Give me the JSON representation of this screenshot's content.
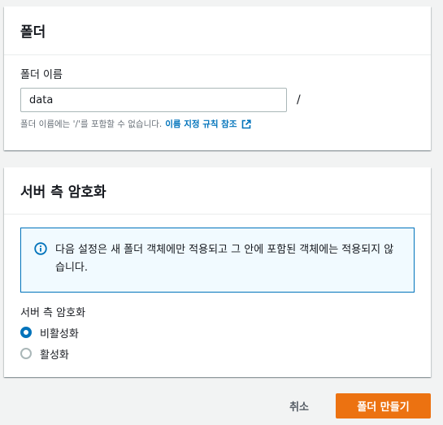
{
  "folder_panel": {
    "title": "폴더",
    "name_label": "폴더 이름",
    "name_value": "data",
    "slash": "/",
    "hint_text": "폴더 이름에는 '/'를 포함할 수 없습니다.",
    "hint_link": "이름 지정 규칙 참조",
    "hint_link_icon": "external-link-icon"
  },
  "encryption_panel": {
    "title": "서버 측 암호화",
    "info_icon": "info-icon",
    "info_text": "다음 설정은 새 폴더 객체에만 적용되고 그 안에 포함된 객체에는 적용되지 않습니다.",
    "group_label": "서버 측 암호화",
    "options": [
      {
        "label": "비활성화",
        "checked": true
      },
      {
        "label": "활성화",
        "checked": false
      }
    ]
  },
  "footer": {
    "cancel_label": "취소",
    "create_label": "폴더 만들기"
  },
  "colors": {
    "accent": "#0073bb",
    "primary_button": "#ec7211",
    "background": "#f2f3f3"
  }
}
